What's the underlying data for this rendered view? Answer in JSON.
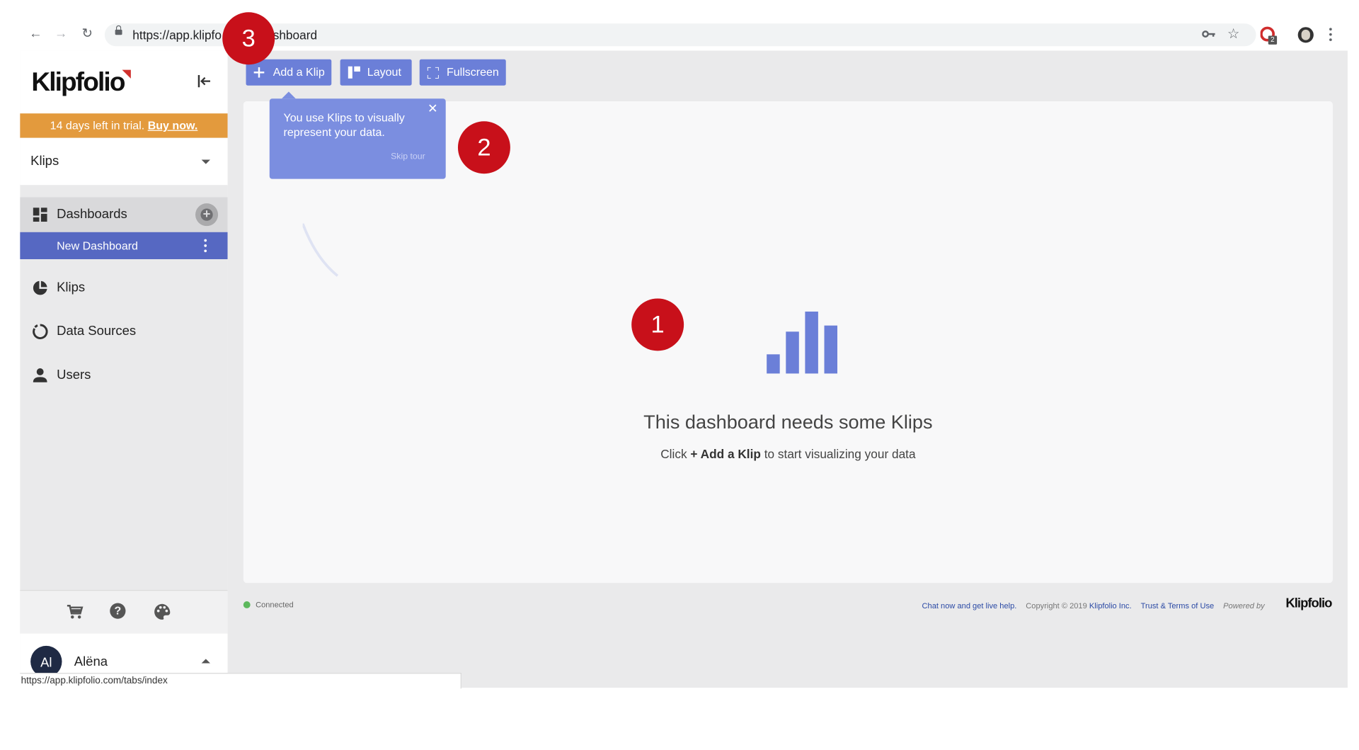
{
  "browser": {
    "url_prefix": "https://app.klipfo",
    "url_suffix": "shboard",
    "extension_badge": "2"
  },
  "sidebar": {
    "brand": "Klipfolio",
    "trial_text": "14 days left in trial.",
    "trial_link": "Buy now.",
    "selector_label": "Klips",
    "nav": {
      "dashboards": "Dashboards",
      "new_dashboard": "New Dashboard",
      "klips": "Klips",
      "data_sources": "Data Sources",
      "users": "Users"
    },
    "help_glyph": "?",
    "user": {
      "initials": "Al",
      "name": "Alëna"
    }
  },
  "toolbar": {
    "add_klip": "Add a Klip",
    "layout": "Layout",
    "fullscreen": "Fullscreen"
  },
  "tooltip": {
    "text": "You use Klips to visually represent your data.",
    "skip": "Skip tour"
  },
  "empty_state": {
    "title": "This dashboard needs some Klips",
    "sub_before": "Click",
    "sub_bold": "+ Add a Klip",
    "sub_after": "to start visualizing your data"
  },
  "footer": {
    "status": "Connected",
    "chat": "Chat now and get live help.",
    "copyright": "Copyright © 2019",
    "company": "Klipfolio Inc.",
    "terms": "Trust & Terms of Use",
    "powered_by": "Powered by",
    "brand": "Klipfolio"
  },
  "status_url": "https://app.klipfolio.com/tabs/index",
  "markers": [
    "1",
    "2",
    "3"
  ],
  "colors": {
    "accent": "#6b7fd8",
    "trial": "#e39a3d",
    "active_nav": "#5668c2",
    "marker": "#c8101a"
  }
}
